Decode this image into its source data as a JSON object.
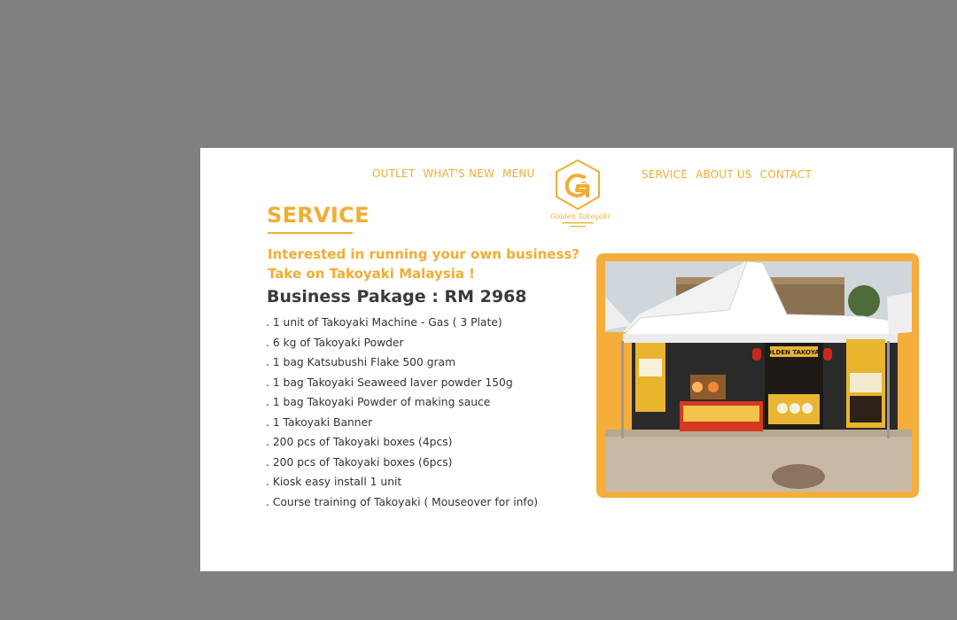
{
  "nav": {
    "left": [
      "OUTLET",
      "WHAT'S NEW",
      "MENU"
    ],
    "right": [
      "SERVICE",
      "ABOUT US",
      "CONTACT"
    ]
  },
  "logo": {
    "name": "Golden Takoyaki"
  },
  "service": {
    "heading": "SERVICE",
    "tagline_line1": "Interested in running your own business?",
    "tagline_line2": "Take on Takoyaki Malaysia !",
    "package_title": "Business Pakage : RM 2968",
    "items": [
      ". 1 unit of Takoyaki Machine - Gas ( 3 Plate)",
      ". 6 kg of Takoyaki Powder",
      ". 1 bag Katsubushi Flake 500 gram",
      ". 1 bag Takoyaki Seaweed laver powder 150g",
      ". 1 bag Takoyaki Powder of making sauce",
      ". 1 Takoyaki Banner",
      ". 200 pcs of Takoyaki boxes (4pcs)",
      ". 200 pcs of Takoyaki boxes (6pcs)",
      ". Kiosk easy install 1 unit",
      ". Course training of Takoyaki ( Mouseover for info)"
    ]
  },
  "photo": {
    "sign_text": "GOLDEN TAKOYAKI"
  },
  "colors": {
    "accent": "#f0ad35",
    "background": "#808080",
    "page": "#ffffff"
  }
}
